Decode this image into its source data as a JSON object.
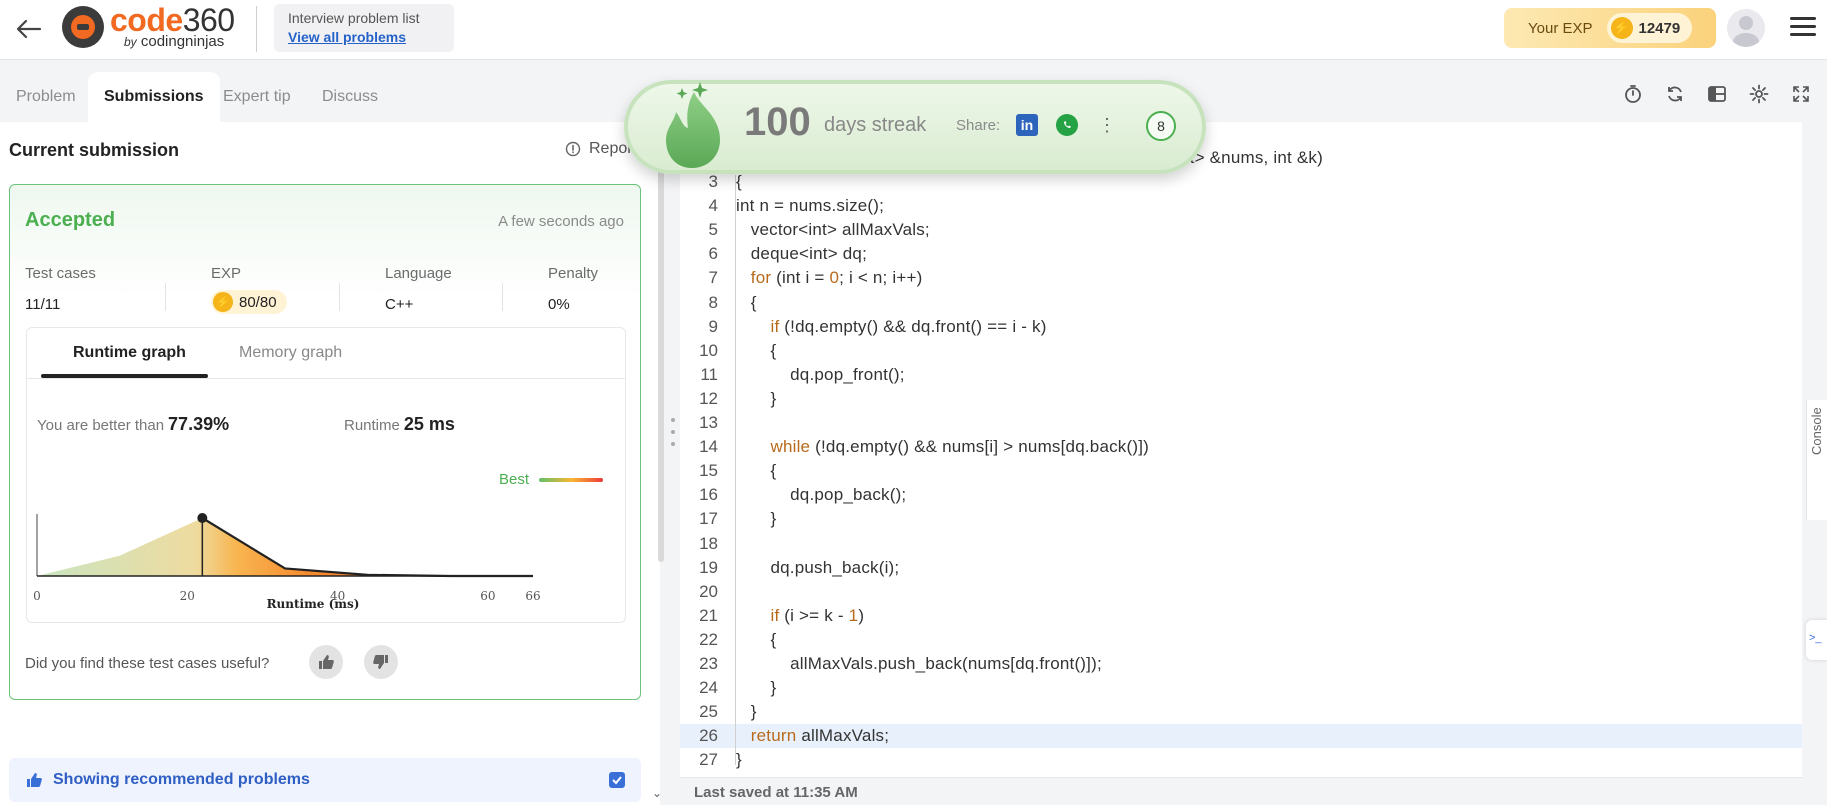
{
  "header": {
    "logo_main_a": "code",
    "logo_main_b": "360",
    "logo_by": "by",
    "logo_sub": "codingninjas",
    "problem_list_title": "Interview problem list",
    "problem_list_link": "View all problems",
    "exp_label": "Your EXP",
    "exp_value": "12479"
  },
  "tabs": [
    "Problem",
    "Submissions",
    "Expert tip",
    "Discuss"
  ],
  "submission": {
    "heading": "Current submission",
    "report": "Report",
    "status": "Accepted",
    "time_ago": "A few seconds ago",
    "stats": [
      {
        "label": "Test cases",
        "value": "11/11"
      },
      {
        "label": "EXP",
        "value": "80/80"
      },
      {
        "label": "Language",
        "value": "C++"
      },
      {
        "label": "Penalty",
        "value": "0%"
      }
    ],
    "graph_tabs": [
      "Runtime graph",
      "Memory graph"
    ],
    "better_label": "You are better than",
    "better_value": "77.39%",
    "runtime_label": "Runtime",
    "runtime_value": "25 ms",
    "legend_best": "Best",
    "useful_question": "Did you find these test cases useful?",
    "recommended": "Showing recommended problems"
  },
  "chart_data": {
    "type": "area",
    "xlabel": "Runtime (ms)",
    "ylabel": "",
    "xlim": [
      0,
      66
    ],
    "xticks": [
      0,
      20,
      40,
      60,
      66
    ],
    "x": [
      0,
      11,
      22,
      33,
      44,
      55,
      66
    ],
    "y": [
      0,
      0.35,
      1.0,
      0.13,
      0.02,
      0.0,
      0.0
    ],
    "marker_x": 22,
    "legend": "Best"
  },
  "editor": {
    "visible_header_fragment": "nt> &nums, int &k)",
    "lines": [
      {
        "n": "3",
        "code": "{"
      },
      {
        "n": "4",
        "code": "int n = nums.size();"
      },
      {
        "n": "5",
        "code": "   vector<int> allMaxVals;"
      },
      {
        "n": "6",
        "code": "   deque<int> dq;"
      },
      {
        "n": "7",
        "code": "   for (int i = 0; i < n; i++)"
      },
      {
        "n": "8",
        "code": "   {"
      },
      {
        "n": "9",
        "code": "       if (!dq.empty() && dq.front() == i - k)"
      },
      {
        "n": "10",
        "code": "       {"
      },
      {
        "n": "11",
        "code": "           dq.pop_front();"
      },
      {
        "n": "12",
        "code": "       }"
      },
      {
        "n": "13",
        "code": ""
      },
      {
        "n": "14",
        "code": "       while (!dq.empty() && nums[i] > nums[dq.back()])"
      },
      {
        "n": "15",
        "code": "       {"
      },
      {
        "n": "16",
        "code": "           dq.pop_back();"
      },
      {
        "n": "17",
        "code": "       }"
      },
      {
        "n": "18",
        "code": ""
      },
      {
        "n": "19",
        "code": "       dq.push_back(i);"
      },
      {
        "n": "20",
        "code": ""
      },
      {
        "n": "21",
        "code": "       if (i >= k - 1)"
      },
      {
        "n": "22",
        "code": "       {"
      },
      {
        "n": "23",
        "code": "           allMaxVals.push_back(nums[dq.front()]);"
      },
      {
        "n": "24",
        "code": "       }"
      },
      {
        "n": "25",
        "code": "   }"
      },
      {
        "n": "26",
        "code": "   return allMaxVals;"
      },
      {
        "n": "27",
        "code": "}"
      }
    ],
    "last_saved": "Last saved at 11:35 AM",
    "console_label": "Console"
  },
  "streak": {
    "days": "100",
    "label": "days streak",
    "share_label": "Share:",
    "badge_count": "8"
  },
  "colors": {
    "accent_orange": "#f26a21",
    "accepted_green": "#4caf50",
    "link_blue": "#2563c9",
    "keyword": "#b86a1c"
  }
}
